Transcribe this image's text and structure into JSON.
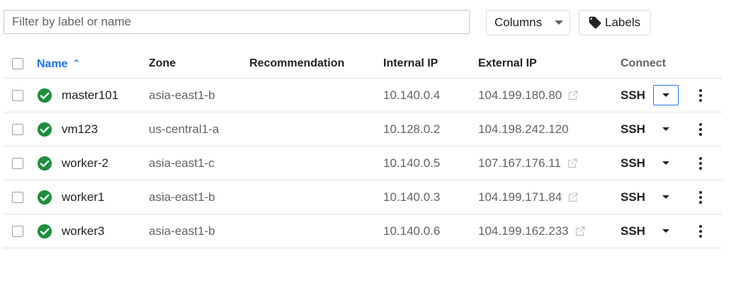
{
  "toolbar": {
    "filter_placeholder": "Filter by label or name",
    "columns_label": "Columns",
    "labels_label": "Labels"
  },
  "table": {
    "headers": {
      "name": "Name",
      "zone": "Zone",
      "recommendation": "Recommendation",
      "internal_ip": "Internal IP",
      "external_ip": "External IP",
      "connect": "Connect"
    },
    "sort": {
      "column": "name",
      "direction": "ascending",
      "icon": "sort-up-arrow"
    },
    "rows": [
      {
        "name": "master101",
        "zone": "asia-east1-b",
        "recommendation": "",
        "internal_ip": "10.140.0.4",
        "external_ip": "104.199.180.80",
        "external_link": true,
        "connect": "SSH",
        "status": "running"
      },
      {
        "name": "vm123",
        "zone": "us-central1-a",
        "recommendation": "",
        "internal_ip": "10.128.0.2",
        "external_ip": "104.198.242.120",
        "external_link": false,
        "connect": "SSH",
        "status": "running"
      },
      {
        "name": "worker-2",
        "zone": "asia-east1-c",
        "recommendation": "",
        "internal_ip": "10.140.0.5",
        "external_ip": "107.167.176.11",
        "external_link": true,
        "connect": "SSH",
        "status": "running"
      },
      {
        "name": "worker1",
        "zone": "asia-east1-b",
        "recommendation": "",
        "internal_ip": "10.140.0.3",
        "external_ip": "104.199.171.84",
        "external_link": true,
        "connect": "SSH",
        "status": "running"
      },
      {
        "name": "worker3",
        "zone": "asia-east1-b",
        "recommendation": "",
        "internal_ip": "10.140.0.6",
        "external_ip": "104.199.162.233",
        "external_link": true,
        "connect": "SSH",
        "status": "running"
      }
    ]
  },
  "colors": {
    "accent": "#1a73e8",
    "status_ok": "#1e8e3e"
  }
}
